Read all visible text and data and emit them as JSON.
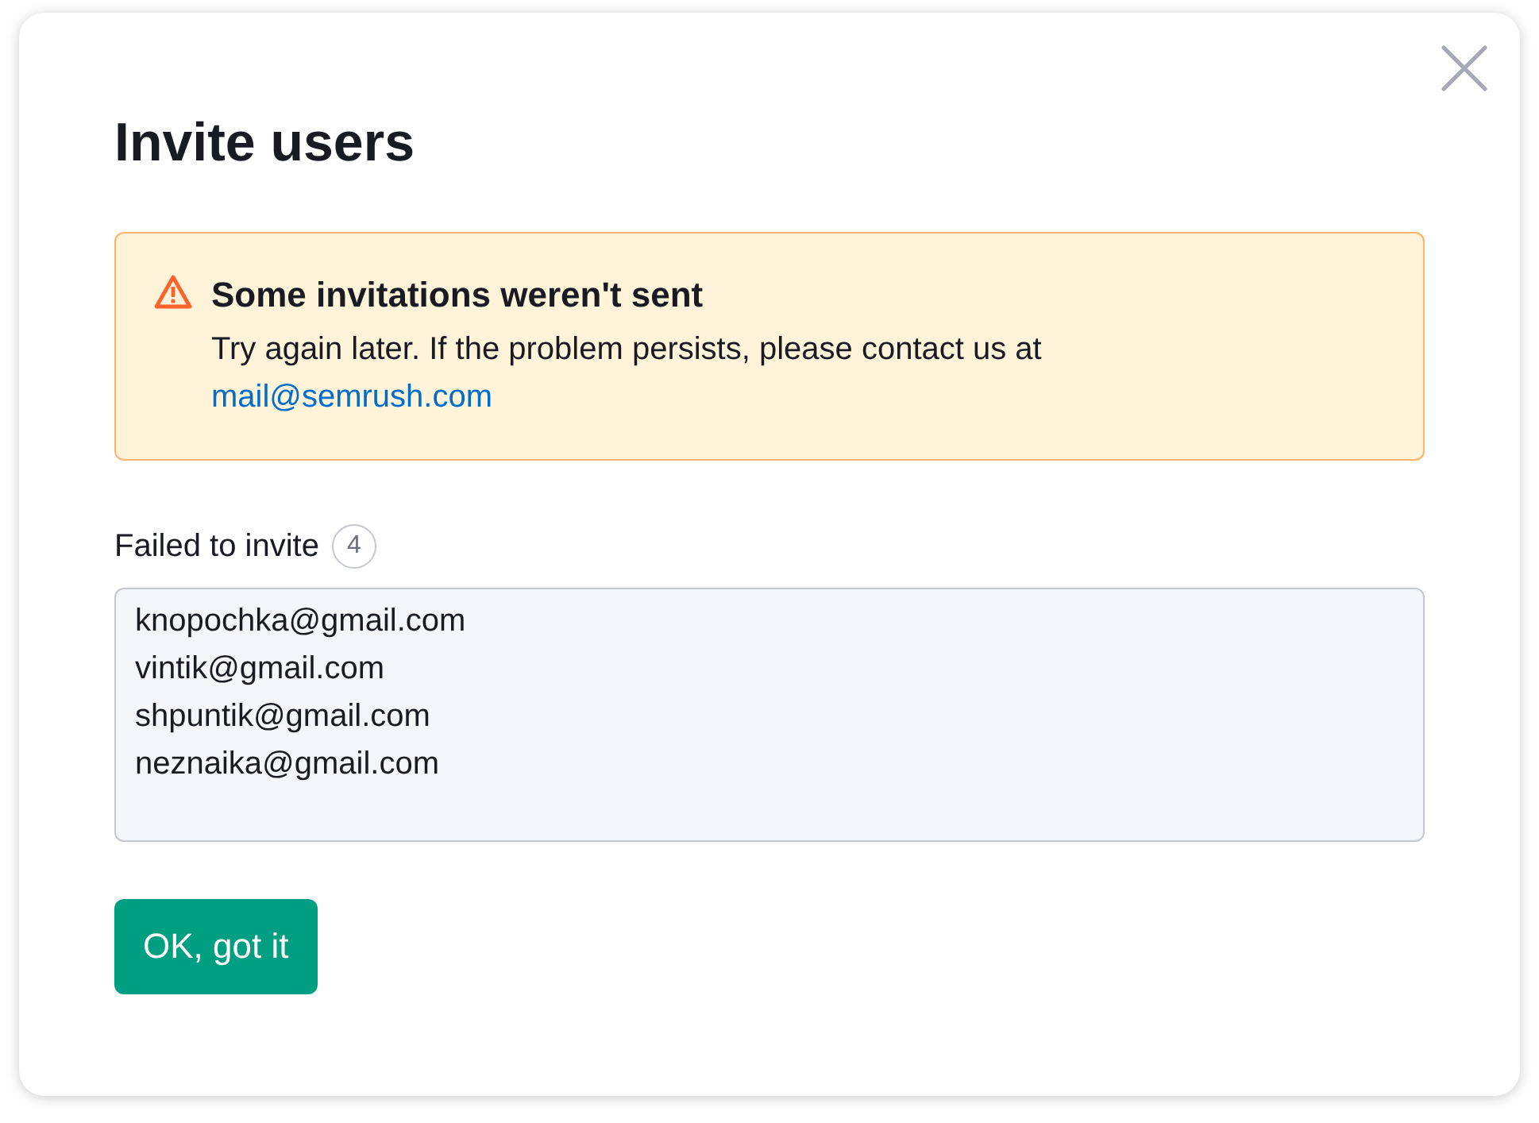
{
  "dialog": {
    "title": "Invite users"
  },
  "alert": {
    "kind": "warning",
    "title": "Some invitations weren't sent",
    "message": "Try again later. If the problem persists, please contact us at",
    "link": "mail@semrush.com"
  },
  "failed": {
    "label": "Failed to invite",
    "count": "4",
    "emails": [
      "knopochka@gmail.com",
      "vintik@gmail.com",
      "shpuntik@gmail.com",
      "neznaika@gmail.com"
    ]
  },
  "buttons": [
    {
      "label": "OK, got it",
      "kind": "primary"
    }
  ]
}
